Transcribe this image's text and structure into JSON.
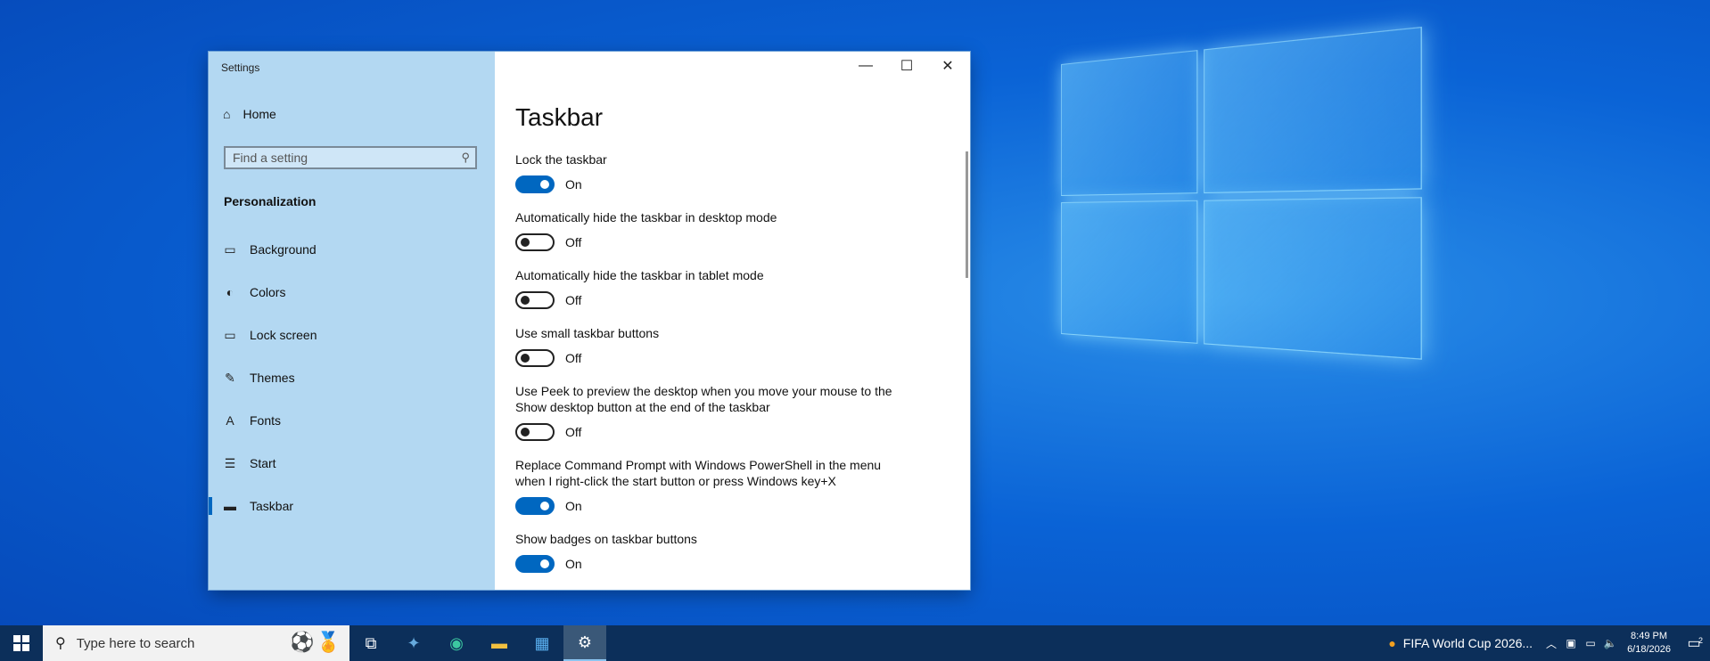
{
  "window": {
    "title": "Settings",
    "controls": {
      "minimize": "—",
      "maximize": "☐",
      "close": "✕"
    }
  },
  "sidebar": {
    "home_label": "Home",
    "search_placeholder": "Find a setting",
    "section_title": "Personalization",
    "items": [
      {
        "label": "Background",
        "icon": "image-icon",
        "glyph": "▭"
      },
      {
        "label": "Colors",
        "icon": "palette-icon",
        "glyph": "◐"
      },
      {
        "label": "Lock screen",
        "icon": "lock-screen-icon",
        "glyph": "▭"
      },
      {
        "label": "Themes",
        "icon": "themes-icon",
        "glyph": "✎"
      },
      {
        "label": "Fonts",
        "icon": "fonts-icon",
        "glyph": "A"
      },
      {
        "label": "Start",
        "icon": "start-icon",
        "glyph": "☰"
      },
      {
        "label": "Taskbar",
        "icon": "taskbar-icon",
        "glyph": "▬",
        "active": true
      }
    ]
  },
  "content": {
    "title": "Taskbar",
    "settings": [
      {
        "label": "Lock the taskbar",
        "state": "On",
        "on": true
      },
      {
        "label": "Automatically hide the taskbar in desktop mode",
        "state": "Off",
        "on": false
      },
      {
        "label": "Automatically hide the taskbar in tablet mode",
        "state": "Off",
        "on": false
      },
      {
        "label": "Use small taskbar buttons",
        "state": "Off",
        "on": false
      },
      {
        "label": "Use Peek to preview the desktop when you move your mouse to the Show desktop button at the end of the taskbar",
        "state": "Off",
        "on": false
      },
      {
        "label": "Replace Command Prompt with Windows PowerShell in the menu when I right-click the start button or press Windows key+X",
        "state": "On",
        "on": true
      },
      {
        "label": "Show badges on taskbar buttons",
        "state": "On",
        "on": true
      }
    ]
  },
  "taskbar": {
    "search_placeholder": "Type here to search",
    "news_text": "FIFA World Cup 2026...",
    "time": "8:49 PM",
    "date": "6/18/2026",
    "notification_count": "2"
  },
  "colors": {
    "accent": "#0067c0",
    "sidebar": "#b3d8f2",
    "taskbar": "#0c2f5a"
  }
}
